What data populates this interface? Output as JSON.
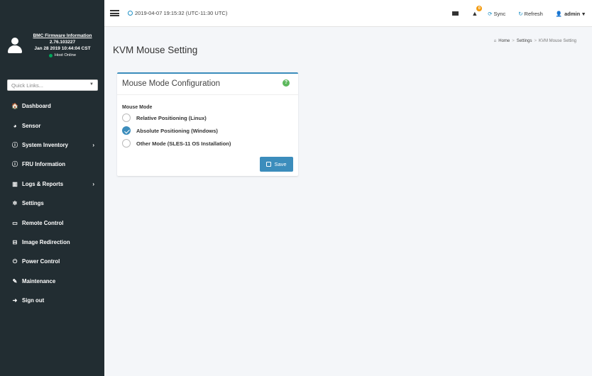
{
  "topbar": {
    "datetime": "2019-04-07 19:15:32 (UTC-11:30 UTC)",
    "notification_count": "0",
    "sync_label": "Sync",
    "refresh_label": "Refresh",
    "user_label": "admin",
    "colors": {
      "accent": "#1e90c6",
      "badge": "#f39c12"
    }
  },
  "sidebar": {
    "profile": {
      "fw_link": "BMC Firmware Information",
      "version": "2.76.103227",
      "build_date": "Jan 28 2019 10:44:04 CST",
      "host_status": "Host Online",
      "status_color": "#00a65a"
    },
    "quick_links": {
      "placeholder": "Quick Links..."
    },
    "items": [
      {
        "label": "Dashboard",
        "icon": "tachometer-icon"
      },
      {
        "label": "Sensor",
        "icon": "gauge-icon"
      },
      {
        "label": "System Inventory",
        "icon": "info-icon"
      },
      {
        "label": "FRU Information",
        "icon": "info-icon"
      },
      {
        "label": "Logs & Reports",
        "icon": "bar-chart-icon"
      },
      {
        "label": "Settings",
        "icon": "gear-icon"
      },
      {
        "label": "Remote Control",
        "icon": "monitor-icon"
      },
      {
        "label": "Image Redirection",
        "icon": "hdd-icon"
      },
      {
        "label": "Power Control",
        "icon": "power-icon"
      },
      {
        "label": "Maintenance",
        "icon": "wrench-icon"
      },
      {
        "label": "Sign out",
        "icon": "sign-out-icon"
      }
    ],
    "colors": {
      "background": "#222d32"
    }
  },
  "main": {
    "page_title": "KVM Mouse Setting",
    "breadcrumb": [
      "Home",
      "Settings",
      "KVM Mouse Setting"
    ],
    "card": {
      "title": "Mouse Mode Configuration",
      "field_label": "Mouse Mode",
      "options": [
        {
          "label": "Relative Positioning (Linux)",
          "checked": false
        },
        {
          "label": "Absolute Positioning (Windows)",
          "checked": true
        },
        {
          "label": "Other Mode (SLES-11 OS Installation)",
          "checked": false
        }
      ],
      "save_label": "Save"
    },
    "colors": {
      "primary": "#3c8dbc",
      "help": "#5cb85c"
    }
  }
}
